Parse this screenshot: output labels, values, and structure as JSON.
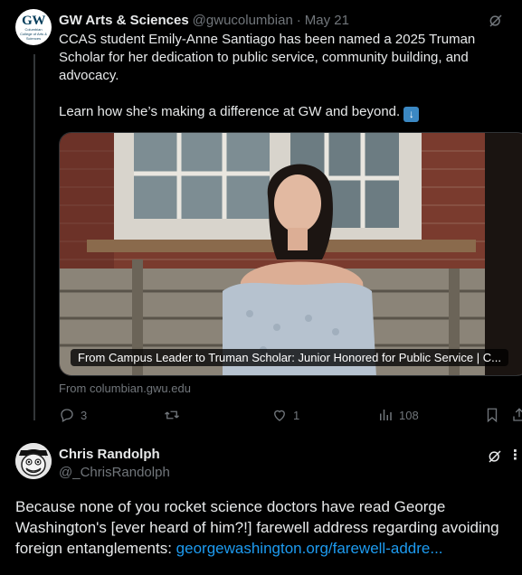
{
  "tweet": {
    "author_name": "GW Arts & Sciences",
    "author_handle": "@gwucolumbian",
    "separator": "·",
    "date": "May 21",
    "avatar": {
      "logo_text": "GW",
      "logo_sub": "Columbian College of Arts & Sciences"
    },
    "text_line1": "CCAS student Emily-Anne Santiago has been named a 2025 Truman Scholar for her dedication to public service, community building, and advocacy.",
    "text_line2": "Learn how she’s making a difference at GW and beyond.",
    "emoji": "down-arrow-emoji",
    "card": {
      "caption": "From Campus Leader to Truman Scholar: Junior Honored for Public Service | C...",
      "source": "From columbian.gwu.edu"
    },
    "actions": {
      "replies": "3",
      "retweets": "",
      "likes": "1",
      "views": "108"
    }
  },
  "reply": {
    "author_name": "Chris Randolph",
    "author_handle": "@_ChrisRandolph",
    "text": "Because none of you rocket science doctors have read George Washington's [ever heard of him?!] farewell address regarding avoiding foreign entanglements: ",
    "link_text": "georgewashington.org/farewell-addre..."
  },
  "colors": {
    "background": "#000000",
    "text": "#e7e9ea",
    "muted": "#71767b",
    "link": "#1d9bf0"
  }
}
